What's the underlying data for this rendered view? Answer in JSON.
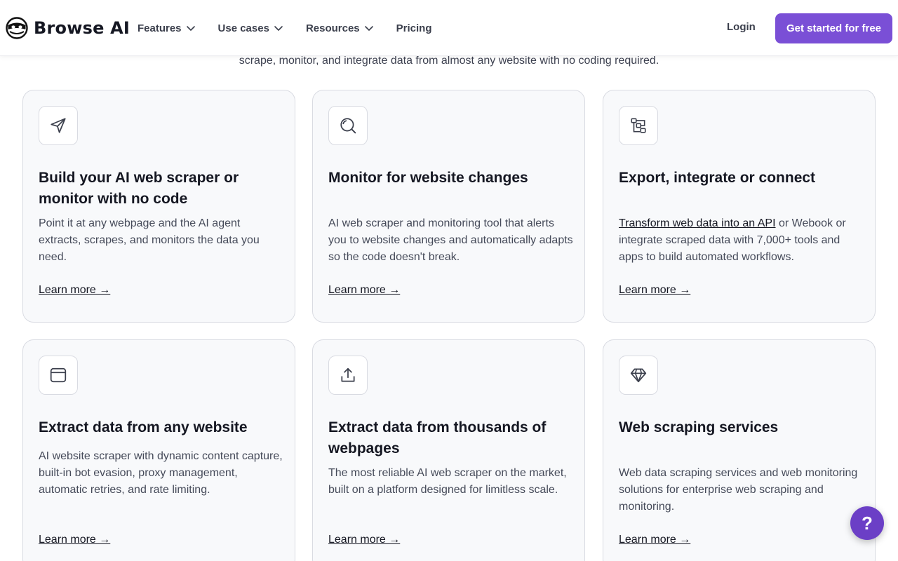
{
  "brand": {
    "name": "Browse AI"
  },
  "nav": {
    "items": [
      {
        "label": "Features",
        "has_dropdown": true
      },
      {
        "label": "Use cases",
        "has_dropdown": true
      },
      {
        "label": "Resources",
        "has_dropdown": true
      },
      {
        "label": "Pricing",
        "has_dropdown": false
      }
    ],
    "login": "Login",
    "cta": "Get started for free"
  },
  "intro": "scrape, monitor, and integrate data from almost any website with no coding required.",
  "cards": [
    {
      "icon": "navigation-arrow-icon",
      "title": "Build your AI web scraper or monitor with no code",
      "desc": "Point it at any webpage and the AI agent extracts, scrapes, and monitors the data you need.",
      "link": "Learn more →"
    },
    {
      "icon": "magnifier-icon",
      "title": "Monitor for website changes",
      "desc": "AI web scraper and monitoring tool that alerts you to website changes and automatically adapts so the code doesn't break.",
      "link": "Learn more →"
    },
    {
      "icon": "integration-icon",
      "title": "Export, integrate or connect",
      "desc_link": "Transform web data into an API",
      "desc": " or Webook or integrate scraped data with 7,000+ tools and apps to build automated workflows.",
      "link": "Learn more →"
    },
    {
      "icon": "browser-window-icon",
      "title": "Extract data from any website",
      "desc": "AI website scraper with dynamic content capture, built-in bot evasion, proxy management, automatic retries, and rate limiting.",
      "link": "Learn more →"
    },
    {
      "icon": "upload-icon",
      "title": "Extract data from thousands of webpages",
      "desc": "The most reliable AI web scraper on the market, built on a platform designed for limitless scale.",
      "link": "Learn more →"
    },
    {
      "icon": "diamond-icon",
      "title": "Web scraping services",
      "desc": "Web data scraping services and web monitoring solutions for enterprise web scraping and monitoring.",
      "link": "Learn more →"
    }
  ],
  "help": {
    "label": "?"
  },
  "colors": {
    "accent": "#7a4fd6",
    "help": "#6b3fc6",
    "card_bg": "#f8f9fb",
    "border": "#d9dbe2"
  }
}
